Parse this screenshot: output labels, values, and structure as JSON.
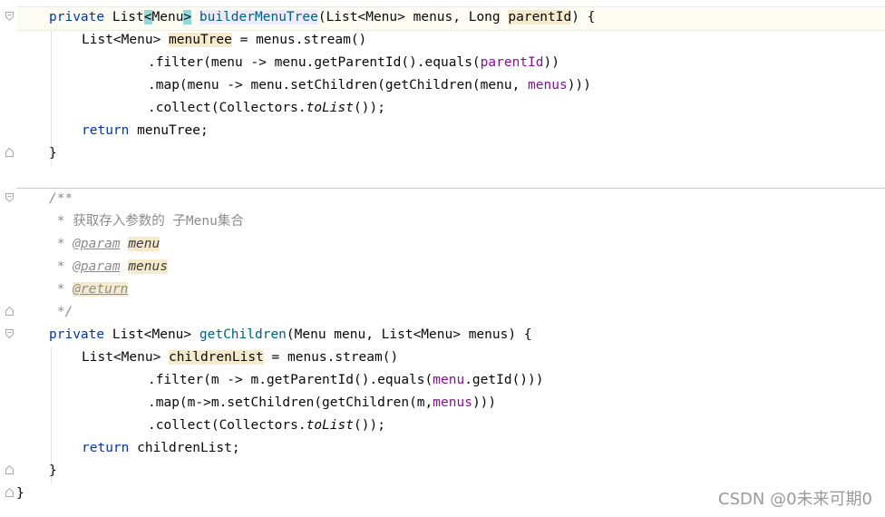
{
  "editor": {
    "lines": {
      "l1": {
        "kw_private": "private",
        "type": " List",
        "lt": "<",
        "menu": "Menu",
        "gt": ">",
        "sp": " ",
        "method": "builderMenuTree",
        "open": "(",
        "p1type": "List<Menu> menus, Long ",
        "p2": "parentId",
        "close": ") {"
      },
      "l2": {
        "type": "List<Menu> ",
        "var": "menuTree",
        "rest": " = menus.stream()"
      },
      "l3": {
        "a": ".filter(menu -> menu.getParentId().equals(",
        "b": "parentId",
        "c": "))"
      },
      "l4": {
        "a": ".map(menu -> menu.setChildren(getChildren(menu, ",
        "b": "menus",
        "c": ")))"
      },
      "l5": {
        "a": ".collect(Collectors.",
        "b": "toList",
        "c": "());"
      },
      "l6": {
        "kw": "return",
        "rest": " menuTree;"
      },
      "l7": {
        "text": "}"
      },
      "l8": {
        "text": "/**"
      },
      "l9": {
        "text": " * 获取存入参数的 子Menu集合"
      },
      "l10": {
        "star": " * ",
        "tag": "@param",
        "sp": " ",
        "val": "menu"
      },
      "l11": {
        "star": " * ",
        "tag": "@param",
        "sp": " ",
        "val": "menus"
      },
      "l12": {
        "star": " * ",
        "tag": "@return"
      },
      "l13": {
        "text": " */"
      },
      "l14": {
        "kw_private": "private",
        "sig1": " List<Menu> ",
        "method": "getChildren",
        "sig2": "(Menu menu, List<Menu> menus) {"
      },
      "l15": {
        "type": "List<Menu> ",
        "var": "childrenList",
        "rest": " = menus.stream()"
      },
      "l16": {
        "a": ".filter(m -> m.getParentId().equals(",
        "b": "menu",
        "c": ".getId()))"
      },
      "l17": {
        "a": ".map(m->m.setChildren(getChildren(m,",
        "b": "menus",
        "c": ")))"
      },
      "l18": {
        "a": ".collect(Collectors.",
        "b": "toList",
        "c": "());"
      },
      "l19": {
        "kw": "return",
        "rest": " childrenList;"
      },
      "l20": {
        "text": "}"
      },
      "l21": {
        "text": "}"
      }
    },
    "icons": [
      "bulb-icon",
      "fold-icon"
    ],
    "colors": {
      "keyword": "#0033b3",
      "method": "#00627a",
      "parameter": "#871094",
      "comment": "#8c8c8c",
      "decl_highlight": "#f5eacb",
      "brace_highlight": "#93d9d9"
    }
  },
  "watermark": "CSDN @0未来可期0"
}
